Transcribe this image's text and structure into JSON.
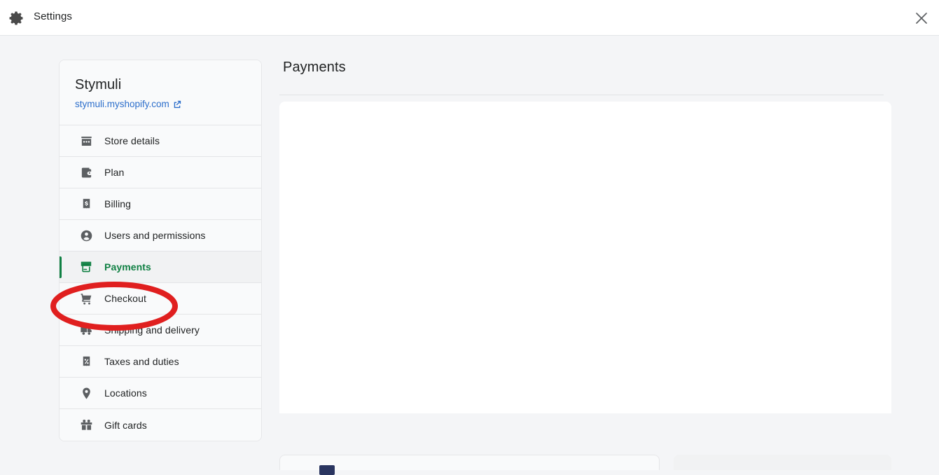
{
  "window": {
    "title": "Settings",
    "gear_icon": "gear-icon",
    "close_icon": "close-icon"
  },
  "sidebar": {
    "store_name": "Stymuli",
    "store_url": "stymuli.myshopify.com",
    "external_link_icon": "external-link-icon",
    "selected_color": "#108043",
    "items": [
      {
        "label": "Store details",
        "icon": "storefront-icon",
        "selected": false
      },
      {
        "label": "Plan",
        "icon": "wallet-icon",
        "selected": false
      },
      {
        "label": "Billing",
        "icon": "receipt-dollar-icon",
        "selected": false
      },
      {
        "label": "Users and permissions",
        "icon": "user-circle-icon",
        "selected": false
      },
      {
        "label": "Payments",
        "icon": "credit-card-icon",
        "selected": true
      },
      {
        "label": "Checkout",
        "icon": "shopping-cart-icon",
        "selected": false
      },
      {
        "label": "Shipping and delivery",
        "icon": "delivery-truck-icon",
        "selected": false
      },
      {
        "label": "Taxes and duties",
        "icon": "receipt-percent-icon",
        "selected": false
      },
      {
        "label": "Locations",
        "icon": "map-pin-icon",
        "selected": false
      },
      {
        "label": "Gift cards",
        "icon": "gift-icon",
        "selected": false
      }
    ]
  },
  "main": {
    "title": "Payments"
  },
  "annotation": {
    "shape": "ellipse",
    "color": "#e01f1f",
    "target": "Payments"
  }
}
